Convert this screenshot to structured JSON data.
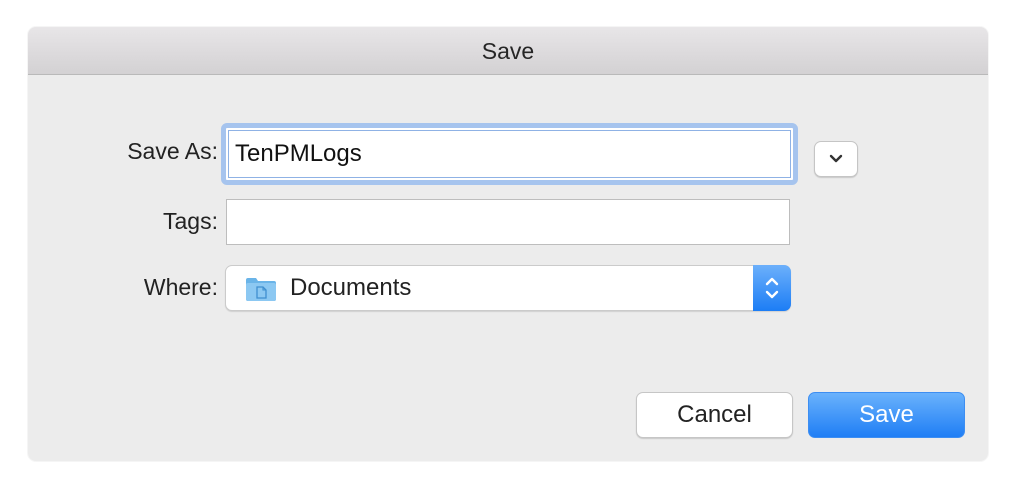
{
  "dialog": {
    "title": "Save"
  },
  "form": {
    "save_as_label": "Save As:",
    "save_as_value": "TenPMLogs",
    "tags_label": "Tags:",
    "tags_value": "",
    "where_label": "Where:",
    "where_value": "Documents"
  },
  "icons": {
    "expand": "chevron-down-icon",
    "location": "folder-icon",
    "popup": "up-down-chevron-icon"
  },
  "buttons": {
    "cancel_label": "Cancel",
    "save_label": "Save"
  },
  "colors": {
    "accent": "#1f7ef5",
    "focus_ring": "#a6c4ee",
    "dialog_bg": "#ececec"
  }
}
